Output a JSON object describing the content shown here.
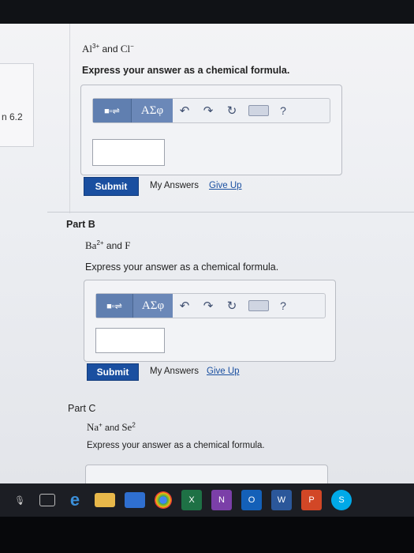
{
  "side_panel": {
    "label": "n 6.2"
  },
  "part_a": {
    "species1": "Al",
    "species1_charge": "3+",
    "conj": "and",
    "species2": "Cl",
    "species2_charge": "−",
    "instruction": "Express your answer as a chemical formula.",
    "input_value": "",
    "submit_label": "Submit",
    "my_answers_label": "My Answers",
    "give_up_label": "Give Up"
  },
  "part_b": {
    "label": "Part B",
    "species1": "Ba",
    "species1_charge": "2+",
    "conj": "and",
    "species2": "F",
    "species2_charge": "",
    "instruction": "Express your answer as a chemical formula.",
    "input_value": "",
    "submit_label": "Submit",
    "my_answers_label": "My Answers",
    "give_up_label": "Give Up"
  },
  "part_c": {
    "label": "Part C",
    "species1": "Na",
    "species1_charge": "+",
    "conj": "and",
    "species2": "Se",
    "species2_charge": "2",
    "instruction": "Express your answer as a chemical formula."
  },
  "toolbar": {
    "symbols_label": "ΑΣφ",
    "undo_icon": "↶",
    "redo_icon": "↷",
    "reset_icon": "↻",
    "help_label": "?"
  },
  "taskbar": {
    "items": [
      "mic-icon",
      "task-view-icon",
      "edge-icon",
      "file-explorer-icon",
      "store-icon",
      "chrome-icon",
      "excel-icon",
      "onenote-icon",
      "outlook-icon",
      "word-icon",
      "powerpoint-icon",
      "skype-icon"
    ]
  }
}
